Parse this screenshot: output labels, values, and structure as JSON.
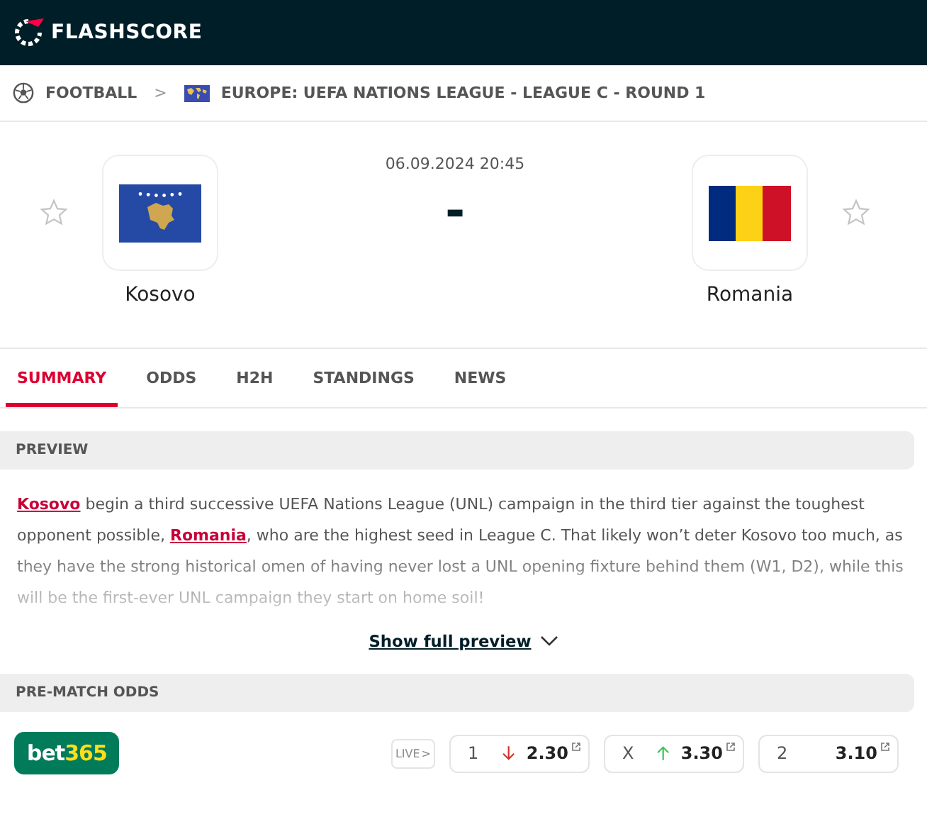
{
  "header": {
    "logo": "FLASHSCORE"
  },
  "breadcrumb": {
    "sport": "FOOTBALL",
    "separator": ">",
    "competition": "EUROPE: UEFA NATIONS LEAGUE - LEAGUE C - ROUND 1"
  },
  "match": {
    "datetime": "06.09.2024 20:45",
    "score": "-",
    "home": {
      "name": "Kosovo",
      "flag": {
        "kind": "kosovo"
      },
      "favourite": false
    },
    "away": {
      "name": "Romania",
      "flag": {
        "kind": "romania"
      },
      "favourite": false
    }
  },
  "tabs": [
    {
      "label": "SUMMARY",
      "selected": true
    },
    {
      "label": "ODDS",
      "selected": false
    },
    {
      "label": "H2H",
      "selected": false
    },
    {
      "label": "STANDINGS",
      "selected": false
    },
    {
      "label": "NEWS",
      "selected": false
    }
  ],
  "preview": {
    "heading": "PREVIEW",
    "segments": [
      {
        "kind": "link",
        "text": "Kosovo"
      },
      {
        "kind": "text",
        "text": " begin a third successive UEFA Nations League (UNL) campaign in the third tier against the toughest opponent possible, "
      },
      {
        "kind": "link",
        "text": "Romania"
      },
      {
        "kind": "text",
        "text": ", who are the highest seed in League C. That likely won’t deter Kosovo too much, as they have the strong historical omen of having never lost a UNL opening fixture behind them (W1, D2), while this will be the first-ever UNL campaign they start on home soil!"
      }
    ],
    "more": "Show full preview"
  },
  "odds": {
    "heading": "PRE-MATCH ODDS",
    "bookmaker": [
      "bet",
      "365"
    ],
    "live": "LIVE",
    "live_caret": ">",
    "items": [
      {
        "label": "1",
        "value": "2.30",
        "kind": "down"
      },
      {
        "label": "X",
        "value": "3.30",
        "kind": "up"
      },
      {
        "label": "2",
        "value": "3.10",
        "kind": "none"
      }
    ]
  }
}
